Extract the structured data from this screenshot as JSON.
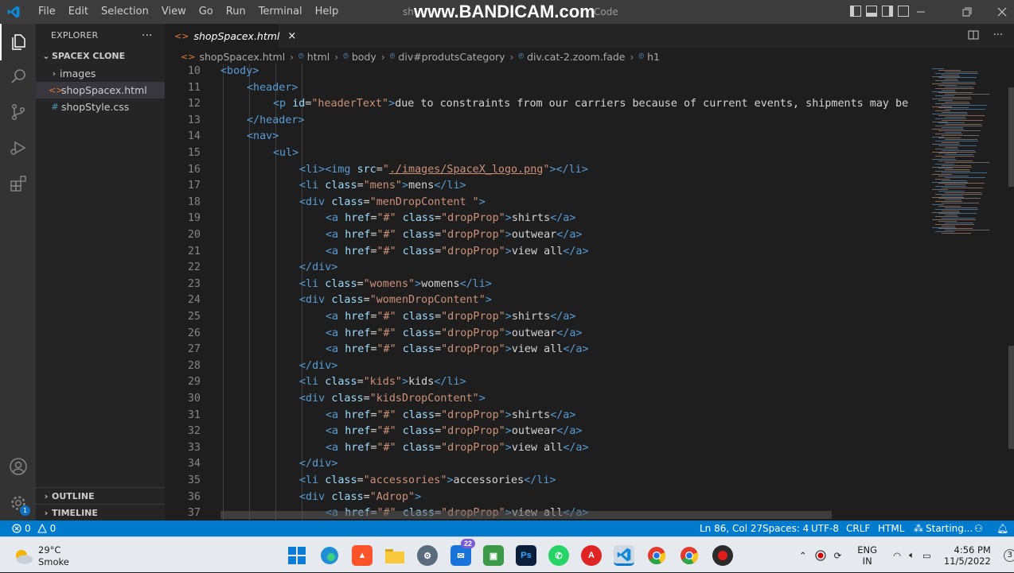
{
  "titlebar": {
    "menu": [
      "File",
      "Edit",
      "Selection",
      "View",
      "Go",
      "Run",
      "Terminal",
      "Help"
    ],
    "window_title_fragment_left": "sh",
    "window_title_fragment_right": "Code",
    "watermark": "www.BANDICAM.com"
  },
  "explorer": {
    "header": "EXPLORER",
    "more": "···",
    "project": "SPACEX CLONE",
    "items": [
      {
        "name": "images",
        "type": "folder"
      },
      {
        "name": "shopSpacex.html",
        "type": "html"
      },
      {
        "name": "shopStyle.css",
        "type": "css"
      }
    ],
    "outline": "OUTLINE",
    "timeline": "TIMELINE"
  },
  "activity_bar": {
    "settings_badge": "1"
  },
  "tab": {
    "label": "shopSpacex.html",
    "close": "×"
  },
  "breadcrumb": [
    "shopSpacex.html",
    "html",
    "body",
    "div#produtsCategory",
    "div.cat-2.zoom.fade",
    "h1"
  ],
  "editor": {
    "lines": [
      {
        "n": "10",
        "i": 0,
        "t": [
          [
            "t",
            "<body>"
          ]
        ]
      },
      {
        "n": "11",
        "i": 1,
        "t": [
          [
            "t",
            "<header>"
          ]
        ]
      },
      {
        "n": "12",
        "i": 2,
        "t": [
          [
            "t",
            "<p "
          ],
          [
            "a",
            "id"
          ],
          [
            "x",
            "="
          ],
          [
            "s",
            "\"headerText\""
          ],
          [
            "t",
            ">"
          ],
          [
            "x",
            "due to constraints from our carriers because of current events, shipments may be"
          ]
        ]
      },
      {
        "n": "13",
        "i": 1,
        "t": [
          [
            "t",
            "</header>"
          ]
        ]
      },
      {
        "n": "14",
        "i": 1,
        "t": [
          [
            "t",
            "<nav>"
          ]
        ]
      },
      {
        "n": "15",
        "i": 2,
        "t": [
          [
            "t",
            "<ul>"
          ]
        ]
      },
      {
        "n": "16",
        "i": 3,
        "t": [
          [
            "t",
            "<li><img "
          ],
          [
            "a",
            "src"
          ],
          [
            "x",
            "="
          ],
          [
            "s",
            "\""
          ],
          [
            "su",
            "./images/SpaceX_logo.png"
          ],
          [
            "s",
            "\""
          ],
          [
            "t",
            "></li>"
          ]
        ]
      },
      {
        "n": "17",
        "i": 3,
        "t": [
          [
            "t",
            "<li "
          ],
          [
            "a",
            "class"
          ],
          [
            "x",
            "="
          ],
          [
            "s",
            "\"mens\""
          ],
          [
            "t",
            ">"
          ],
          [
            "x",
            "mens"
          ],
          [
            "t",
            "</li>"
          ]
        ]
      },
      {
        "n": "18",
        "i": 3,
        "t": [
          [
            "t",
            "<div "
          ],
          [
            "a",
            "class"
          ],
          [
            "x",
            "="
          ],
          [
            "s",
            "\"menDropContent \""
          ],
          [
            "t",
            ">"
          ]
        ]
      },
      {
        "n": "19",
        "i": 4,
        "t": [
          [
            "t",
            "<a "
          ],
          [
            "a",
            "href"
          ],
          [
            "x",
            "="
          ],
          [
            "s",
            "\"#\""
          ],
          [
            "x",
            " "
          ],
          [
            "a",
            "class"
          ],
          [
            "x",
            "="
          ],
          [
            "s",
            "\"dropProp\""
          ],
          [
            "t",
            ">"
          ],
          [
            "x",
            "shirts"
          ],
          [
            "t",
            "</a>"
          ]
        ]
      },
      {
        "n": "20",
        "i": 4,
        "t": [
          [
            "t",
            "<a "
          ],
          [
            "a",
            "href"
          ],
          [
            "x",
            "="
          ],
          [
            "s",
            "\"#\""
          ],
          [
            "x",
            " "
          ],
          [
            "a",
            "class"
          ],
          [
            "x",
            "="
          ],
          [
            "s",
            "\"dropProp\""
          ],
          [
            "t",
            ">"
          ],
          [
            "x",
            "outwear"
          ],
          [
            "t",
            "</a>"
          ]
        ]
      },
      {
        "n": "21",
        "i": 4,
        "t": [
          [
            "t",
            "<a "
          ],
          [
            "a",
            "href"
          ],
          [
            "x",
            "="
          ],
          [
            "s",
            "\"#\""
          ],
          [
            "x",
            " "
          ],
          [
            "a",
            "class"
          ],
          [
            "x",
            "="
          ],
          [
            "s",
            "\"dropProp\""
          ],
          [
            "t",
            ">"
          ],
          [
            "x",
            "view all"
          ],
          [
            "t",
            "</a>"
          ]
        ]
      },
      {
        "n": "22",
        "i": 3,
        "t": [
          [
            "t",
            "</div>"
          ]
        ]
      },
      {
        "n": "23",
        "i": 3,
        "t": [
          [
            "t",
            "<li "
          ],
          [
            "a",
            "class"
          ],
          [
            "x",
            "="
          ],
          [
            "s",
            "\"womens\""
          ],
          [
            "t",
            ">"
          ],
          [
            "x",
            "womens"
          ],
          [
            "t",
            "</li>"
          ]
        ]
      },
      {
        "n": "24",
        "i": 3,
        "t": [
          [
            "t",
            "<div "
          ],
          [
            "a",
            "class"
          ],
          [
            "x",
            "="
          ],
          [
            "s",
            "\"womenDropContent\""
          ],
          [
            "t",
            ">"
          ]
        ]
      },
      {
        "n": "25",
        "i": 4,
        "t": [
          [
            "t",
            "<a "
          ],
          [
            "a",
            "href"
          ],
          [
            "x",
            "="
          ],
          [
            "s",
            "\"#\""
          ],
          [
            "x",
            " "
          ],
          [
            "a",
            "class"
          ],
          [
            "x",
            "="
          ],
          [
            "s",
            "\"dropProp\""
          ],
          [
            "t",
            ">"
          ],
          [
            "x",
            "shirts"
          ],
          [
            "t",
            "</a>"
          ]
        ]
      },
      {
        "n": "26",
        "i": 4,
        "t": [
          [
            "t",
            "<a "
          ],
          [
            "a",
            "href"
          ],
          [
            "x",
            "="
          ],
          [
            "s",
            "\"#\""
          ],
          [
            "x",
            " "
          ],
          [
            "a",
            "class"
          ],
          [
            "x",
            "="
          ],
          [
            "s",
            "\"dropProp\""
          ],
          [
            "t",
            ">"
          ],
          [
            "x",
            "outwear"
          ],
          [
            "t",
            "</a>"
          ]
        ]
      },
      {
        "n": "27",
        "i": 4,
        "t": [
          [
            "t",
            "<a "
          ],
          [
            "a",
            "href"
          ],
          [
            "x",
            "="
          ],
          [
            "s",
            "\"#\""
          ],
          [
            "x",
            " "
          ],
          [
            "a",
            "class"
          ],
          [
            "x",
            "="
          ],
          [
            "s",
            "\"dropProp\""
          ],
          [
            "t",
            ">"
          ],
          [
            "x",
            "view all"
          ],
          [
            "t",
            "</a>"
          ]
        ]
      },
      {
        "n": "28",
        "i": 3,
        "t": [
          [
            "t",
            "</div>"
          ]
        ]
      },
      {
        "n": "29",
        "i": 3,
        "t": [
          [
            "t",
            "<li "
          ],
          [
            "a",
            "class"
          ],
          [
            "x",
            "="
          ],
          [
            "s",
            "\"kids\""
          ],
          [
            "t",
            ">"
          ],
          [
            "x",
            "kids"
          ],
          [
            "t",
            "</li>"
          ]
        ]
      },
      {
        "n": "30",
        "i": 3,
        "t": [
          [
            "t",
            "<div "
          ],
          [
            "a",
            "class"
          ],
          [
            "x",
            "="
          ],
          [
            "s",
            "\"kidsDropContent\""
          ],
          [
            "t",
            ">"
          ]
        ]
      },
      {
        "n": "31",
        "i": 4,
        "t": [
          [
            "t",
            "<a "
          ],
          [
            "a",
            "href"
          ],
          [
            "x",
            "="
          ],
          [
            "s",
            "\"#\""
          ],
          [
            "x",
            " "
          ],
          [
            "a",
            "class"
          ],
          [
            "x",
            "="
          ],
          [
            "s",
            "\"dropProp\""
          ],
          [
            "t",
            ">"
          ],
          [
            "x",
            "shirts"
          ],
          [
            "t",
            "</a>"
          ]
        ]
      },
      {
        "n": "32",
        "i": 4,
        "t": [
          [
            "t",
            "<a "
          ],
          [
            "a",
            "href"
          ],
          [
            "x",
            "="
          ],
          [
            "s",
            "\"#\""
          ],
          [
            "x",
            " "
          ],
          [
            "a",
            "class"
          ],
          [
            "x",
            "="
          ],
          [
            "s",
            "\"dropProp\""
          ],
          [
            "t",
            ">"
          ],
          [
            "x",
            "outwear"
          ],
          [
            "t",
            "</a>"
          ]
        ]
      },
      {
        "n": "33",
        "i": 4,
        "t": [
          [
            "t",
            "<a "
          ],
          [
            "a",
            "href"
          ],
          [
            "x",
            "="
          ],
          [
            "s",
            "\"#\""
          ],
          [
            "x",
            " "
          ],
          [
            "a",
            "class"
          ],
          [
            "x",
            "="
          ],
          [
            "s",
            "\"dropProp\""
          ],
          [
            "t",
            ">"
          ],
          [
            "x",
            "view all"
          ],
          [
            "t",
            "</a>"
          ]
        ]
      },
      {
        "n": "34",
        "i": 3,
        "t": [
          [
            "t",
            "</div>"
          ]
        ]
      },
      {
        "n": "35",
        "i": 3,
        "t": [
          [
            "t",
            "<li "
          ],
          [
            "a",
            "class"
          ],
          [
            "x",
            "="
          ],
          [
            "s",
            "\"accessories\""
          ],
          [
            "t",
            ">"
          ],
          [
            "x",
            "accessories"
          ],
          [
            "t",
            "</li>"
          ]
        ]
      },
      {
        "n": "36",
        "i": 3,
        "t": [
          [
            "t",
            "<div "
          ],
          [
            "a",
            "class"
          ],
          [
            "x",
            "="
          ],
          [
            "s",
            "\"Adrop\""
          ],
          [
            "t",
            ">"
          ]
        ]
      },
      {
        "n": "37",
        "i": 4,
        "t": [
          [
            "t",
            "<a "
          ],
          [
            "a",
            "href"
          ],
          [
            "x",
            "="
          ],
          [
            "s",
            "\"#\""
          ],
          [
            "x",
            " "
          ],
          [
            "a",
            "class"
          ],
          [
            "x",
            "="
          ],
          [
            "s",
            "\"dropProp\""
          ],
          [
            "t",
            ">"
          ],
          [
            "x",
            "view all"
          ],
          [
            "t",
            "</a>"
          ]
        ]
      }
    ]
  },
  "statusbar": {
    "errors": "0",
    "warnings": "0",
    "position": "Ln 86, Col 27",
    "spaces": "Spaces: 4",
    "encoding": "UTF-8",
    "eol": "CRLF",
    "language": "HTML",
    "live": "Starting..."
  },
  "taskbar": {
    "temp": "29°C",
    "weather": "Smoke",
    "mail_badge": "22",
    "lang1": "ENG",
    "lang2": "IN",
    "time": "4:56 PM",
    "date": "11/5/2022",
    "notifications": "3"
  },
  "colors": {
    "accent": "#007acc",
    "tag": "#569cd6",
    "attr": "#9cdcfe",
    "string": "#ce9178"
  }
}
